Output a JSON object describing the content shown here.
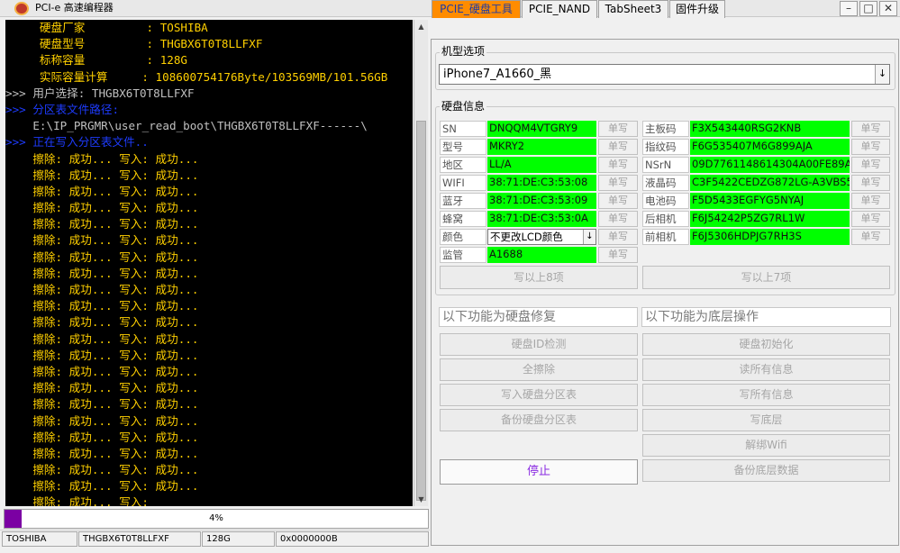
{
  "window": {
    "title": "PCI-e 高速编程器",
    "minimize": "–",
    "maximize": "□",
    "close": "✕"
  },
  "console": {
    "lines": [
      {
        "text": "     硬盘厂家         : TOSHIBA",
        "color": "#ffd000"
      },
      {
        "text": "     硬盘型号         : THGBX6T0T8LLFXF",
        "color": "#ffd000"
      },
      {
        "text": "     标称容量         : 128G",
        "color": "#ffd000"
      },
      {
        "text": "     实际容量计算     : 108600754176Byte/103569MB/101.56GB",
        "color": "#ffd000"
      },
      {
        "text": ">>> 用户选择: THGBX6T0T8LLFXF",
        "color": "#c0c0c0"
      },
      {
        "text": ">>> 分区表文件路径:",
        "color": "#1e3cff"
      },
      {
        "text": "    E:\\IP_PRGMR\\user_read_boot\\THGBX6T0T8LLFXF------\\",
        "color": "#c0c0c0"
      },
      {
        "text": ">>> 正在写入分区表文件..",
        "color": "#1e3cff"
      },
      {
        "text": "    擦除: 成功... 写入: 成功...",
        "color": "#ffd000"
      },
      {
        "text": "    擦除: 成功... 写入: 成功...",
        "color": "#ffd000"
      },
      {
        "text": "    擦除: 成功... 写入: 成功...",
        "color": "#ffd000"
      },
      {
        "text": "    擦除: 成功... 写入: 成功...",
        "color": "#ffd000"
      },
      {
        "text": "    擦除: 成功... 写入: 成功...",
        "color": "#ffd000"
      },
      {
        "text": "    擦除: 成功... 写入: 成功...",
        "color": "#ffd000"
      },
      {
        "text": "    擦除: 成功... 写入: 成功...",
        "color": "#ffd000"
      },
      {
        "text": "    擦除: 成功... 写入: 成功...",
        "color": "#ffd000"
      },
      {
        "text": "    擦除: 成功... 写入: 成功...",
        "color": "#ffd000"
      },
      {
        "text": "    擦除: 成功... 写入: 成功...",
        "color": "#ffd000"
      },
      {
        "text": "    擦除: 成功... 写入: 成功...",
        "color": "#ffd000"
      },
      {
        "text": "    擦除: 成功... 写入: 成功...",
        "color": "#ffd000"
      },
      {
        "text": "    擦除: 成功... 写入: 成功...",
        "color": "#ffd000"
      },
      {
        "text": "    擦除: 成功... 写入: 成功...",
        "color": "#ffd000"
      },
      {
        "text": "    擦除: 成功... 写入: 成功...",
        "color": "#ffd000"
      },
      {
        "text": "    擦除: 成功... 写入: 成功...",
        "color": "#ffd000"
      },
      {
        "text": "    擦除: 成功... 写入: 成功...",
        "color": "#ffd000"
      },
      {
        "text": "    擦除: 成功... 写入: 成功...",
        "color": "#ffd000"
      },
      {
        "text": "    擦除: 成功... 写入: 成功...",
        "color": "#ffd000"
      },
      {
        "text": "    擦除: 成功... 写入: 成功...",
        "color": "#ffd000"
      },
      {
        "text": "    擦除: 成功... 写入: 成功...",
        "color": "#ffd000"
      },
      {
        "text": "    擦除: 成功... 写入:",
        "color": "#ffd000"
      }
    ]
  },
  "progress": {
    "value": 4,
    "label": "4%",
    "color": "#7b00a3"
  },
  "statusbar": [
    "TOSHIBA",
    "THGBX6T0T8LLFXF",
    "128G",
    "0x0000000B"
  ],
  "tabs": [
    {
      "label": "PCIE_硬盘工具",
      "active": true
    },
    {
      "label": "PCIE_NAND",
      "active": false
    },
    {
      "label": "TabSheet3",
      "active": false
    },
    {
      "label": "固件升级",
      "active": false
    }
  ],
  "model": {
    "group_title": "机型选项",
    "selected": "iPhone7_A1660_黑",
    "dropdown_icon": "↓"
  },
  "disk_info": {
    "title": "硬盘信息",
    "write_label": "单写",
    "left": [
      {
        "label": "SN",
        "value": "DNQQM4VTGRY9"
      },
      {
        "label": "型号",
        "value": "MKRY2"
      },
      {
        "label": "地区",
        "value": "LL/A"
      },
      {
        "label": "WIFI",
        "value": "38:71:DE:C3:53:08"
      },
      {
        "label": "蓝牙",
        "value": "38:71:DE:C3:53:09"
      },
      {
        "label": "蜂窝",
        "value": "38:71:DE:C3:53:0A"
      },
      {
        "label": "颜色",
        "value": "不更改LCD颜色"
      },
      {
        "label": "监管",
        "value": "A1688"
      }
    ],
    "right": [
      {
        "label": "主板码",
        "value": "F3X543440RSG2KNB"
      },
      {
        "label": "指纹码",
        "value": "F6G535407M6G899AJA"
      },
      {
        "label": "NSrN",
        "value": "09D7761148614304A00FE89A"
      },
      {
        "label": "液晶码",
        "value": "C3F5422CEDZG872LG-A3VBS5"
      },
      {
        "label": "电池码",
        "value": "F5D5433EGFYG5NYAJ"
      },
      {
        "label": "后相机",
        "value": "F6J54242P5ZG7RL1W"
      },
      {
        "label": "前相机",
        "value": "F6J5306HDPJG7RH3S"
      }
    ],
    "write_left_all": "写以上8项",
    "write_right_all": "写以上7项"
  },
  "repair": {
    "left_title": "以下功能为硬盘修复",
    "right_title": "以下功能为底层操作",
    "left_buttons": [
      "硬盘ID检测",
      "全擦除",
      "写入硬盘分区表",
      "备份硬盘分区表"
    ],
    "right_buttons": [
      "硬盘初始化",
      "读所有信息",
      "写所有信息",
      "写底层",
      "解绑Wifi",
      "备份底层数据"
    ],
    "stop": "停止"
  }
}
